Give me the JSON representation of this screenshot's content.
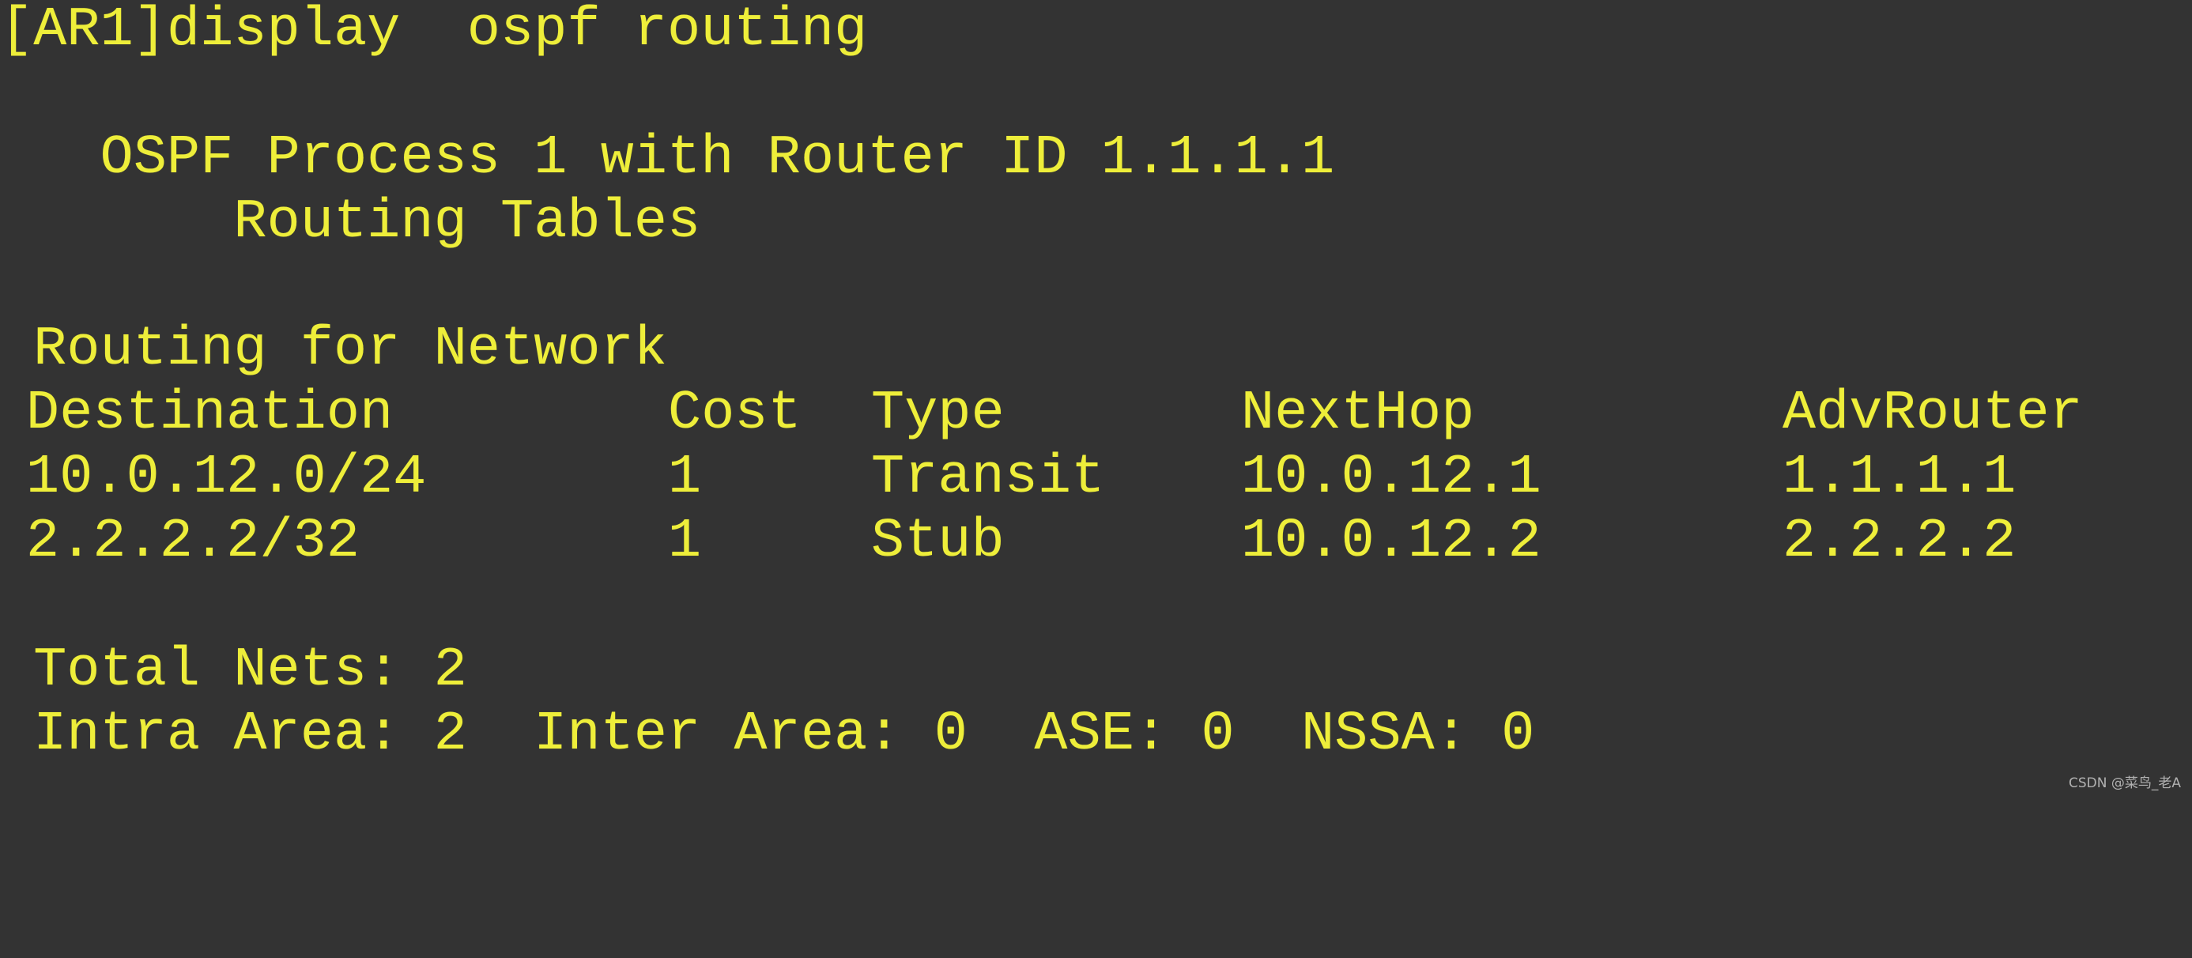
{
  "terminal": {
    "command_line": "[AR1]display  ospf routing",
    "process_header": "   OSPF Process 1 with Router ID 1.1.1.1",
    "tables_header": "       Routing Tables",
    "section_title": " Routing for Network",
    "table": {
      "columns": [
        "Destination",
        "Cost",
        "Type",
        "NextHop",
        "AdvRouter"
      ],
      "rows": [
        [
          "10.0.12.0/24",
          "1",
          "Transit",
          "10.0.12.1",
          "1.1.1.1"
        ],
        [
          "2.2.2.2/32",
          "1",
          "Stub",
          "10.0.12.2",
          "2.2.2.2"
        ]
      ]
    },
    "total_nets": " Total Nets: 2",
    "area_summary": " Intra Area: 2  Inter Area: 0  ASE: 0  NSSA: 0"
  },
  "colors": {
    "background": "#333333",
    "text": "#eeee3a"
  },
  "watermark": "CSDN @菜鸟_老A"
}
